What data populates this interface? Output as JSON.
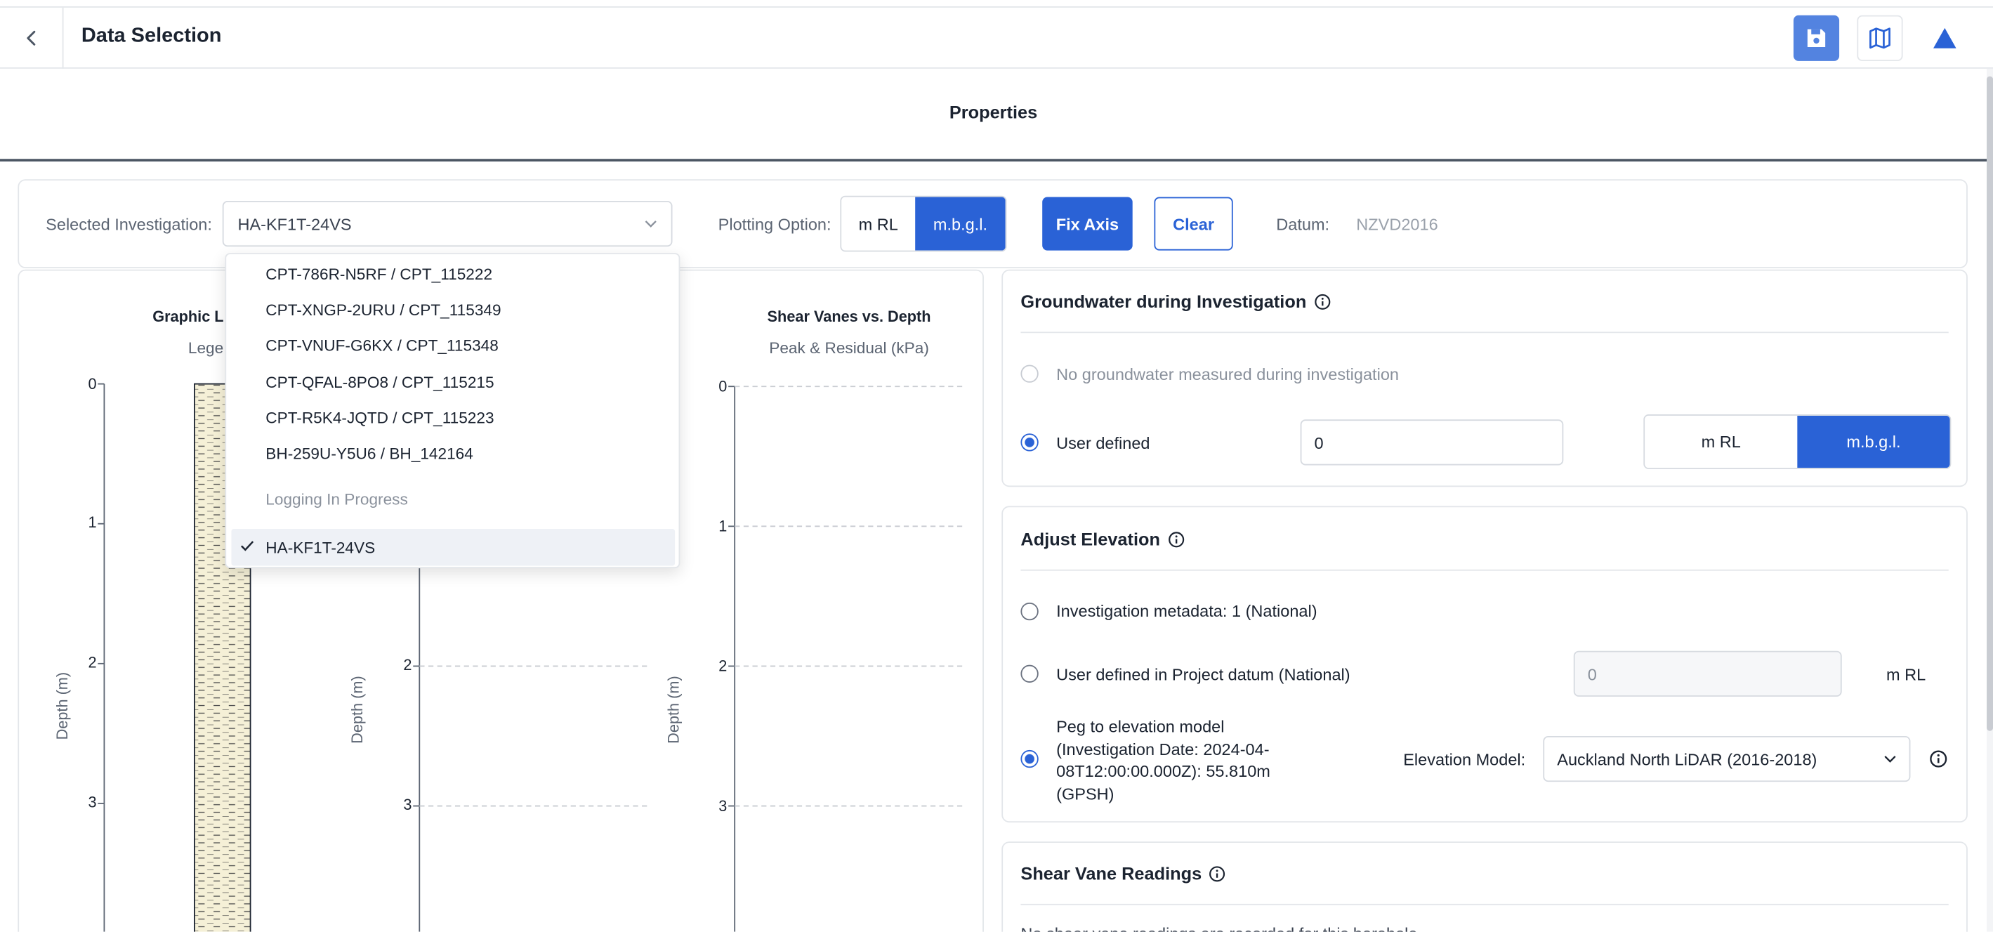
{
  "header": {
    "title": "Data Selection",
    "back_icon": "chevron-left-icon",
    "actions": [
      "save-icon",
      "map-icon",
      "triangle-icon"
    ],
    "accent": "#2a62d6"
  },
  "properties_title": "Properties",
  "toolbar": {
    "investigation_label": "Selected Investigation:",
    "investigation_value": "HA-KF1T-24VS",
    "plotting_label": "Plotting Option:",
    "plot_opt_mrl": "m RL",
    "plot_opt_mbgl": "m.b.g.l.",
    "plot_selected": "m.b.g.l.",
    "fix_axis": "Fix Axis",
    "clear": "Clear",
    "datum_label": "Datum:",
    "datum_value": "NZVD2016"
  },
  "dropdown": {
    "items": [
      "CPT-786R-N5RF / CPT_115222",
      "CPT-XNGP-2URU / CPT_115349",
      "CPT-VNUF-G6KX / CPT_115348",
      "CPT-QFAL-8PO8 / CPT_115215",
      "CPT-R5K4-JQTD / CPT_115223",
      "BH-259U-Y5U6 / BH_142164"
    ],
    "group_label": "Logging In Progress",
    "selected": "HA-KF1T-24VS"
  },
  "charts": {
    "graphic": {
      "title": "Graphic L",
      "subtitle": "Lege",
      "ylabel": "Depth (m)",
      "ticks": [
        "0",
        "1",
        "2",
        "3"
      ]
    },
    "middle": {
      "ylabel": "Depth (m)",
      "ticks": [
        "2",
        "3"
      ]
    },
    "shear": {
      "title": "Shear Vanes vs. Depth",
      "subtitle": "Peak & Residual (kPa)",
      "ylabel": "Depth (m)",
      "ticks": [
        "0",
        "1",
        "2",
        "3"
      ]
    }
  },
  "groundwater": {
    "title": "Groundwater during Investigation",
    "opt_none": "No groundwater measured during investigation",
    "opt_user": "User defined",
    "value": "0",
    "unit_mrl": "m RL",
    "unit_mbgl": "m.b.g.l.",
    "selected_unit": "m.b.g.l."
  },
  "elevation": {
    "title": "Adjust Elevation",
    "opt_metadata": "Investigation metadata: 1 (National)",
    "opt_user": "User defined in Project datum (National)",
    "user_value": "0",
    "user_unit": "m RL",
    "opt_peg_lines": [
      "Peg to elevation model",
      "(Investigation Date: 2024-04-",
      "08T12:00:00.000Z): 55.810m",
      "(GPSH)"
    ],
    "model_label": "Elevation Model:",
    "model_value": "Auckland North LiDAR (2016-2018)"
  },
  "shear_vane": {
    "title": "Shear Vane Readings",
    "message": "No shear vane readings are recorded for this borehole"
  }
}
